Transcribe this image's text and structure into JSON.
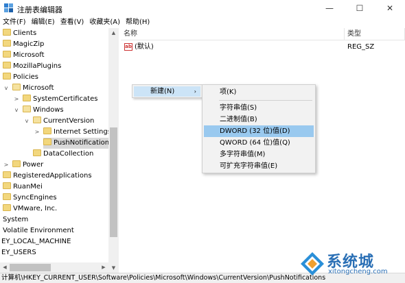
{
  "window": {
    "title": "注册表编辑器",
    "minimize": "—",
    "maximize": "☐",
    "close": "✕"
  },
  "menu": [
    "文件(F)",
    "编辑(E)",
    "查看(V)",
    "收藏夹(A)",
    "帮助(H)"
  ],
  "tree": [
    {
      "label": "Clients",
      "icon": "folder-icon"
    },
    {
      "label": "MagicZip",
      "icon": "folder-icon"
    },
    {
      "label": "Microsoft",
      "icon": "folder-icon"
    },
    {
      "label": "MozillaPlugins",
      "icon": "folder-icon"
    },
    {
      "label": "Policies",
      "icon": "folder-icon"
    },
    {
      "label": "Microsoft",
      "icon": "folder-icon",
      "expander": "v"
    },
    {
      "label": "SystemCertificates",
      "icon": "folder-icon",
      "expander": ">"
    },
    {
      "label": "Windows",
      "icon": "folder-icon",
      "expander": "v"
    },
    {
      "label": "CurrentVersion",
      "icon": "folder-icon",
      "expander": "v"
    },
    {
      "label": "Internet Settings",
      "icon": "folder-icon",
      "expander": ">"
    },
    {
      "label": "PushNotifications",
      "icon": "folder-icon",
      "selected": true
    },
    {
      "label": "DataCollection",
      "icon": "folder-icon"
    },
    {
      "label": "Power",
      "icon": "folder-icon",
      "expander": ">"
    },
    {
      "label": "RegisteredApplications",
      "icon": "folder-icon"
    },
    {
      "label": "RuanMei",
      "icon": "folder-icon"
    },
    {
      "label": "SyncEngines",
      "icon": "folder-icon"
    },
    {
      "label": "VMware, Inc.",
      "icon": "folder-icon"
    },
    {
      "label": "System"
    },
    {
      "label": "Volatile Environment"
    },
    {
      "label": "EY_LOCAL_MACHINE"
    },
    {
      "label": "EY_USERS"
    }
  ],
  "list": {
    "columns": {
      "name": "名称",
      "type": "类型"
    },
    "rows": [
      {
        "name": "(默认)",
        "type": "REG_SZ",
        "icon": "ab-string-icon",
        "icon_text": "ab"
      }
    ]
  },
  "context_menu": {
    "new_label": "新建(N)",
    "arrow": "›"
  },
  "submenu": {
    "items": [
      "项(K)",
      "字符串值(S)",
      "二进制值(B)",
      "DWORD (32 位)值(D)",
      "QWORD (64 位)值(Q)",
      "多字符串值(M)",
      "可扩充字符串值(E)"
    ],
    "highlighted": "DWORD (32 位)值(D)"
  },
  "status_bar": {
    "path": "计算机\\HKEY_CURRENT_USER\\Software\\Policies\\Microsoft\\Windows\\CurrentVersion\\PushNotifications"
  },
  "watermark": {
    "brand": "系统城",
    "url": "xitongcheng.com"
  },
  "colors": {
    "selection": "#d9d9d9",
    "menu_highlight": "#99c9ef",
    "folder": "#f2d77e",
    "watermark": "#2a6fb5"
  }
}
